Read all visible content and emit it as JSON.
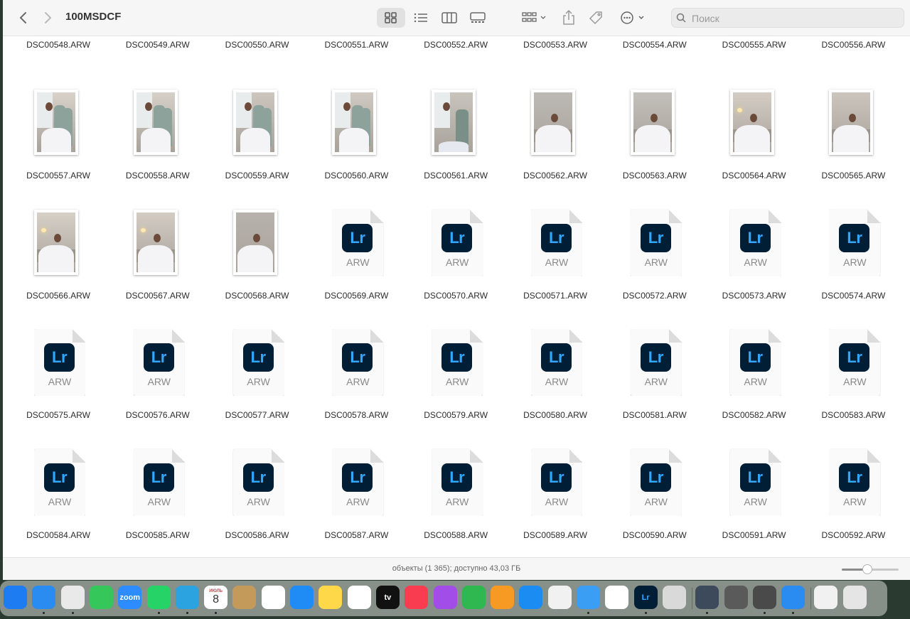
{
  "window": {
    "title": "100MSDCF"
  },
  "toolbar": {
    "back_icon": "chevron-left-icon",
    "forward_icon": "chevron-right-icon",
    "view_icons": [
      "icon-view-icon",
      "list-view-icon",
      "column-view-icon",
      "gallery-view-icon"
    ],
    "group_icon": "group-by-icon",
    "share_icon": "share-icon",
    "tag_icon": "tag-icon",
    "more_icon": "more-actions-icon"
  },
  "search": {
    "placeholder": "Поиск",
    "value": ""
  },
  "files": {
    "partial_row": [
      "DSC00548.ARW",
      "DSC00549.ARW",
      "DSC00550.ARW",
      "DSC00551.ARW",
      "DSC00552.ARW",
      "DSC00553.ARW",
      "DSC00554.ARW",
      "DSC00555.ARW",
      "DSC00556.ARW"
    ],
    "items": [
      {
        "name": "DSC00557.ARW",
        "kind": "photo"
      },
      {
        "name": "DSC00558.ARW",
        "kind": "photo"
      },
      {
        "name": "DSC00559.ARW",
        "kind": "photo"
      },
      {
        "name": "DSC00560.ARW",
        "kind": "photo"
      },
      {
        "name": "DSC00561.ARW",
        "kind": "photo"
      },
      {
        "name": "DSC00562.ARW",
        "kind": "photo"
      },
      {
        "name": "DSC00563.ARW",
        "kind": "photo"
      },
      {
        "name": "DSC00564.ARW",
        "kind": "photo"
      },
      {
        "name": "DSC00565.ARW",
        "kind": "photo"
      },
      {
        "name": "DSC00566.ARW",
        "kind": "photo"
      },
      {
        "name": "DSC00567.ARW",
        "kind": "photo"
      },
      {
        "name": "DSC00568.ARW",
        "kind": "photo"
      },
      {
        "name": "DSC00569.ARW",
        "kind": "lr"
      },
      {
        "name": "DSC00570.ARW",
        "kind": "lr"
      },
      {
        "name": "DSC00571.ARW",
        "kind": "lr"
      },
      {
        "name": "DSC00572.ARW",
        "kind": "lr"
      },
      {
        "name": "DSC00573.ARW",
        "kind": "lr"
      },
      {
        "name": "DSC00574.ARW",
        "kind": "lr"
      },
      {
        "name": "DSC00575.ARW",
        "kind": "lr"
      },
      {
        "name": "DSC00576.ARW",
        "kind": "lr"
      },
      {
        "name": "DSC00577.ARW",
        "kind": "lr"
      },
      {
        "name": "DSC00578.ARW",
        "kind": "lr"
      },
      {
        "name": "DSC00579.ARW",
        "kind": "lr"
      },
      {
        "name": "DSC00580.ARW",
        "kind": "lr"
      },
      {
        "name": "DSC00581.ARW",
        "kind": "lr"
      },
      {
        "name": "DSC00582.ARW",
        "kind": "lr"
      },
      {
        "name": "DSC00583.ARW",
        "kind": "lr"
      },
      {
        "name": "DSC00584.ARW",
        "kind": "lr"
      },
      {
        "name": "DSC00585.ARW",
        "kind": "lr"
      },
      {
        "name": "DSC00586.ARW",
        "kind": "lr"
      },
      {
        "name": "DSC00587.ARW",
        "kind": "lr"
      },
      {
        "name": "DSC00588.ARW",
        "kind": "lr"
      },
      {
        "name": "DSC00589.ARW",
        "kind": "lr"
      },
      {
        "name": "DSC00590.ARW",
        "kind": "lr"
      },
      {
        "name": "DSC00591.ARW",
        "kind": "lr"
      },
      {
        "name": "DSC00592.ARW",
        "kind": "lr"
      }
    ],
    "lr_badge": "Lr",
    "lr_ext": "ARW"
  },
  "status": {
    "text": "объекты (1 365); доступно 43,03 ГБ",
    "zoom_level": 0.45
  },
  "dock": {
    "apps": [
      {
        "name": "mail-app-icon",
        "color": "#1e7cf2",
        "running": false
      },
      {
        "name": "safari-app-icon",
        "color": "#2a8cf0",
        "running": true
      },
      {
        "name": "chrome-app-icon",
        "color": "#e9e9e9",
        "running": true
      },
      {
        "name": "facetime-app-icon",
        "color": "#35c759",
        "running": false
      },
      {
        "name": "zoom-app-icon",
        "color": "#2d8cff",
        "label": "zoom",
        "running": false
      },
      {
        "name": "whatsapp-app-icon",
        "color": "#25d366",
        "running": true
      },
      {
        "name": "telegram-app-icon",
        "color": "#2aa3e0",
        "running": true
      },
      {
        "name": "calendar-app-icon",
        "color": "#ffffff",
        "label": "8",
        "sublabel": "ИЮЛЬ",
        "running": true
      },
      {
        "name": "contacts-app-icon",
        "color": "#c49a5b",
        "running": false
      },
      {
        "name": "reminders-app-icon",
        "color": "#ffffff",
        "running": false
      },
      {
        "name": "keynote-app-icon",
        "color": "#1f8cf5",
        "running": false
      },
      {
        "name": "notes-app-icon",
        "color": "#ffd84a",
        "running": false
      },
      {
        "name": "freeform-app-icon",
        "color": "#ffffff",
        "running": false
      },
      {
        "name": "appletv-app-icon",
        "color": "#111111",
        "label": "tv",
        "running": false
      },
      {
        "name": "music-app-icon",
        "color": "#fa3c50",
        "running": false
      },
      {
        "name": "podcasts-app-icon",
        "color": "#a34de8",
        "running": false
      },
      {
        "name": "numbers-app-icon",
        "color": "#2fb84f",
        "running": false
      },
      {
        "name": "pages-app-icon",
        "color": "#f79a23",
        "running": false
      },
      {
        "name": "appstore-app-icon",
        "color": "#1a8cf2",
        "running": false
      },
      {
        "name": "creative-cloud-app-icon",
        "color": "#f1f1f1",
        "running": false
      },
      {
        "name": "screen-sharing-app-icon",
        "color": "#3a9ef5",
        "running": true
      },
      {
        "name": "capcut-app-icon",
        "color": "#ffffff",
        "running": false
      },
      {
        "name": "lightroom-app-icon",
        "color": "#001e36",
        "label": "Lr",
        "running": true
      },
      {
        "name": "iphone-mirroring-app-icon",
        "color": "#d9d9d9",
        "running": false
      },
      {
        "name": "quicktime-app-icon",
        "color": "#3d4a5c",
        "running": true
      },
      {
        "name": "printer-app-icon",
        "color": "#5a5a5a",
        "running": false
      },
      {
        "name": "calculator-app-icon",
        "color": "#4a4a4a",
        "running": true
      },
      {
        "name": "downloads-folder-icon",
        "color": "#2a8cf0",
        "running": true
      },
      {
        "name": "audio-file-icon",
        "color": "#f1f1f1",
        "running": false
      },
      {
        "name": "trash-icon",
        "color": "#e5e5e5",
        "running": false
      }
    ]
  },
  "colors": {
    "lr_badge_bg": "#001e36",
    "lr_badge_fg": "#31a8ff"
  }
}
